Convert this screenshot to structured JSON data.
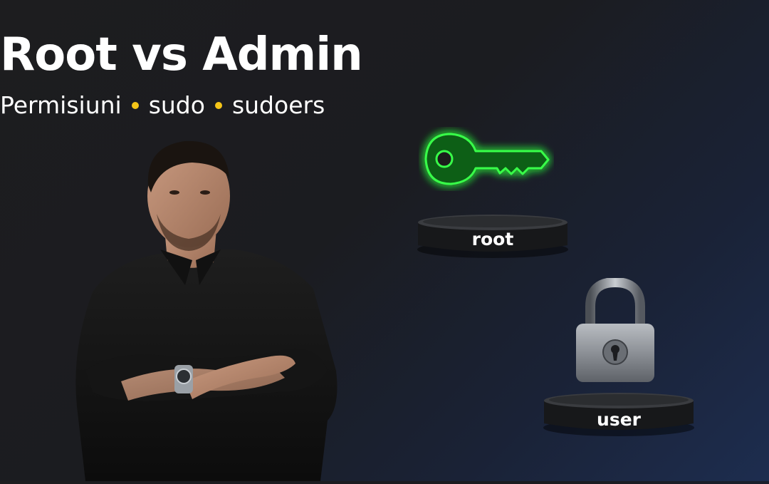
{
  "title": "Root vs Admin",
  "subtitle": {
    "items": [
      "Permisiuni",
      "sudo",
      "sudoers"
    ],
    "separator_color": "#f5c518"
  },
  "icons": {
    "key": "key-icon",
    "lock": "padlock-icon"
  },
  "colors": {
    "key_glow": "#39ff4a",
    "background_dark": "#1d1d1f",
    "background_blue": "#1d2d4f"
  },
  "pedestals": {
    "root_label": "root",
    "user_label": "user"
  }
}
